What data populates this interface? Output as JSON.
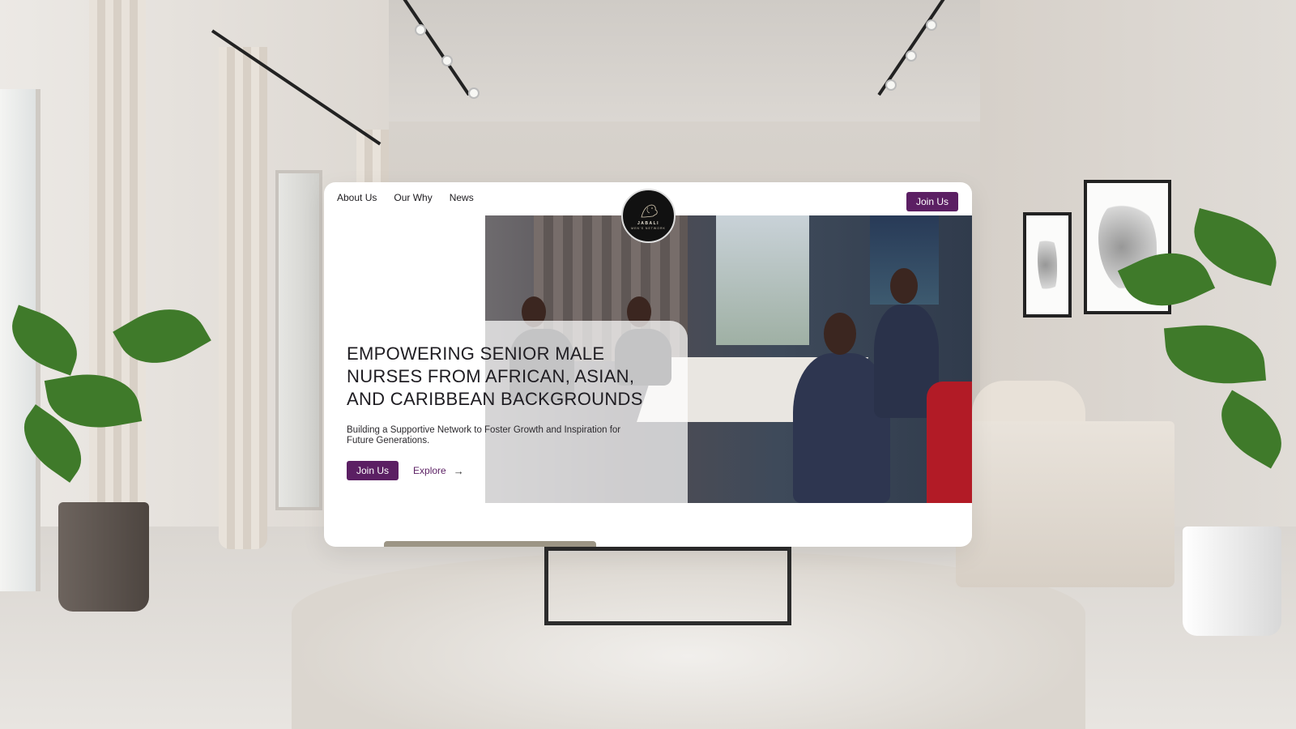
{
  "nav": {
    "links": [
      "About Us",
      "Our Why",
      "News"
    ],
    "join_label": "Join Us"
  },
  "logo": {
    "name": "JABALI",
    "subtitle": "MEN'S NETWORK"
  },
  "hero": {
    "title_line1": "EMPOWERING SENIOR MALE",
    "title_line2": "NURSES FROM AFRICAN, ASIAN,",
    "title_line3": "AND CARIBBEAN BACKGROUNDS",
    "subtitle": "Building a Supportive Network to Foster Growth and Inspiration for Future Generations.",
    "join_label": "Join Us",
    "explore_label": "Explore",
    "arrow_glyph": "→"
  },
  "colors": {
    "accent": "#5b1f63",
    "title": "#1f1d22"
  }
}
